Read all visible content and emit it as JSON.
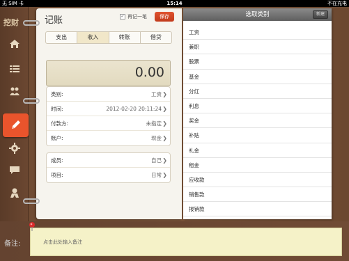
{
  "status": {
    "carrier": "无 SIM 卡",
    "time": "15:14",
    "battery": "不在充电"
  },
  "sidebar": {
    "logo": "挖财",
    "items": [
      {
        "name": "home",
        "icon": "home-icon"
      },
      {
        "name": "list",
        "icon": "list-icon"
      },
      {
        "name": "members",
        "icon": "people-icon"
      },
      {
        "name": "record",
        "icon": "pencil-icon",
        "active": true
      },
      {
        "name": "settings",
        "icon": "gear-icon"
      },
      {
        "name": "messages",
        "icon": "chat-icon"
      },
      {
        "name": "profile",
        "icon": "person-icon"
      }
    ],
    "active_color": "#e9542c"
  },
  "left": {
    "title": "记账",
    "remember_label": "再记一笔",
    "remember_checked": true,
    "save_label": "保存",
    "tabs": [
      "支出",
      "收入",
      "转账",
      "借贷"
    ],
    "active_tab": "收入",
    "amount": "0.00",
    "fields": [
      {
        "label": "类别:",
        "value": "工资"
      },
      {
        "label": "时间:",
        "value": "2012-02-20 20:11:24"
      },
      {
        "label": "付款方:",
        "value": "未指定"
      },
      {
        "label": "账户:",
        "value": "现金"
      }
    ],
    "fields2": [
      {
        "label": "成员:",
        "value": "自己"
      },
      {
        "label": "项目:",
        "value": "日常"
      }
    ]
  },
  "right": {
    "title": "选取类别",
    "new_label": "新建",
    "categories": [
      "工资",
      "兼职",
      "股票",
      "基金",
      "分红",
      "利息",
      "奖金",
      "补贴",
      "礼金",
      "租金",
      "应收款",
      "销售款",
      "报销款"
    ]
  },
  "memo": {
    "label": "备注:",
    "placeholder": "点击此处输入备注"
  }
}
